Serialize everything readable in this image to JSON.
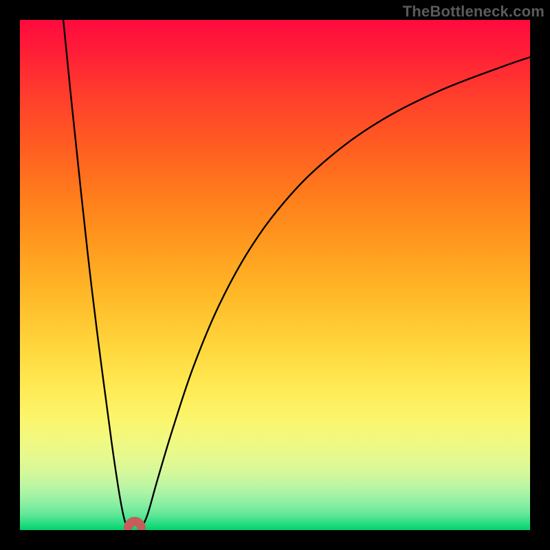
{
  "attribution": "TheBottleneck.com",
  "chart_data": {
    "type": "line",
    "title": "",
    "xlabel": "",
    "ylabel": "",
    "xlim": [
      0,
      100
    ],
    "ylim": [
      0,
      100
    ],
    "grid": false,
    "legend": false,
    "series": [
      {
        "name": "bottleneck-curve-left",
        "x": [
          8.5,
          10,
          12,
          14,
          16,
          18,
          19.5,
          20.5,
          21.2
        ],
        "y": [
          100,
          85,
          66,
          48,
          32,
          17,
          7,
          2,
          0.5
        ]
      },
      {
        "name": "floor-notch",
        "x": [
          21.2,
          21.5,
          22.0,
          22.5,
          23.0,
          23.5,
          23.8
        ],
        "y": [
          0.5,
          1.2,
          1.6,
          1.7,
          1.6,
          1.2,
          0.5
        ]
      },
      {
        "name": "bottleneck-curve-right",
        "x": [
          23.8,
          25,
          27,
          30,
          34,
          39,
          45,
          52,
          60,
          70,
          82,
          95,
          100
        ],
        "y": [
          0.5,
          3,
          10,
          20,
          32,
          44,
          55,
          64.5,
          72.5,
          79.8,
          86,
          91,
          92.7
        ]
      }
    ],
    "notch": {
      "color": "#c55d5a",
      "stroke_width_px": 13,
      "x_range": [
        21.2,
        23.8
      ]
    },
    "curve": {
      "color": "#000000",
      "stroke_width_px": 2.4
    },
    "gradient_stops": [
      {
        "pos": 0,
        "color": "#ff0a3e"
      },
      {
        "pos": 6,
        "color": "#ff1d37"
      },
      {
        "pos": 14,
        "color": "#ff3b2d"
      },
      {
        "pos": 24,
        "color": "#ff5a22"
      },
      {
        "pos": 34,
        "color": "#ff7b1c"
      },
      {
        "pos": 44,
        "color": "#ff9a1e"
      },
      {
        "pos": 54,
        "color": "#ffb928"
      },
      {
        "pos": 64,
        "color": "#ffd63c"
      },
      {
        "pos": 72,
        "color": "#ffea54"
      },
      {
        "pos": 78,
        "color": "#fbf56c"
      },
      {
        "pos": 82,
        "color": "#f2f97f"
      },
      {
        "pos": 85.5,
        "color": "#e6f98e"
      },
      {
        "pos": 88.5,
        "color": "#d6f89a"
      },
      {
        "pos": 91,
        "color": "#c0f6a2"
      },
      {
        "pos": 93,
        "color": "#a6f3a5"
      },
      {
        "pos": 95,
        "color": "#88eea2"
      },
      {
        "pos": 97,
        "color": "#60e798"
      },
      {
        "pos": 98.5,
        "color": "#2fde86"
      },
      {
        "pos": 100,
        "color": "#00d36f"
      }
    ]
  }
}
